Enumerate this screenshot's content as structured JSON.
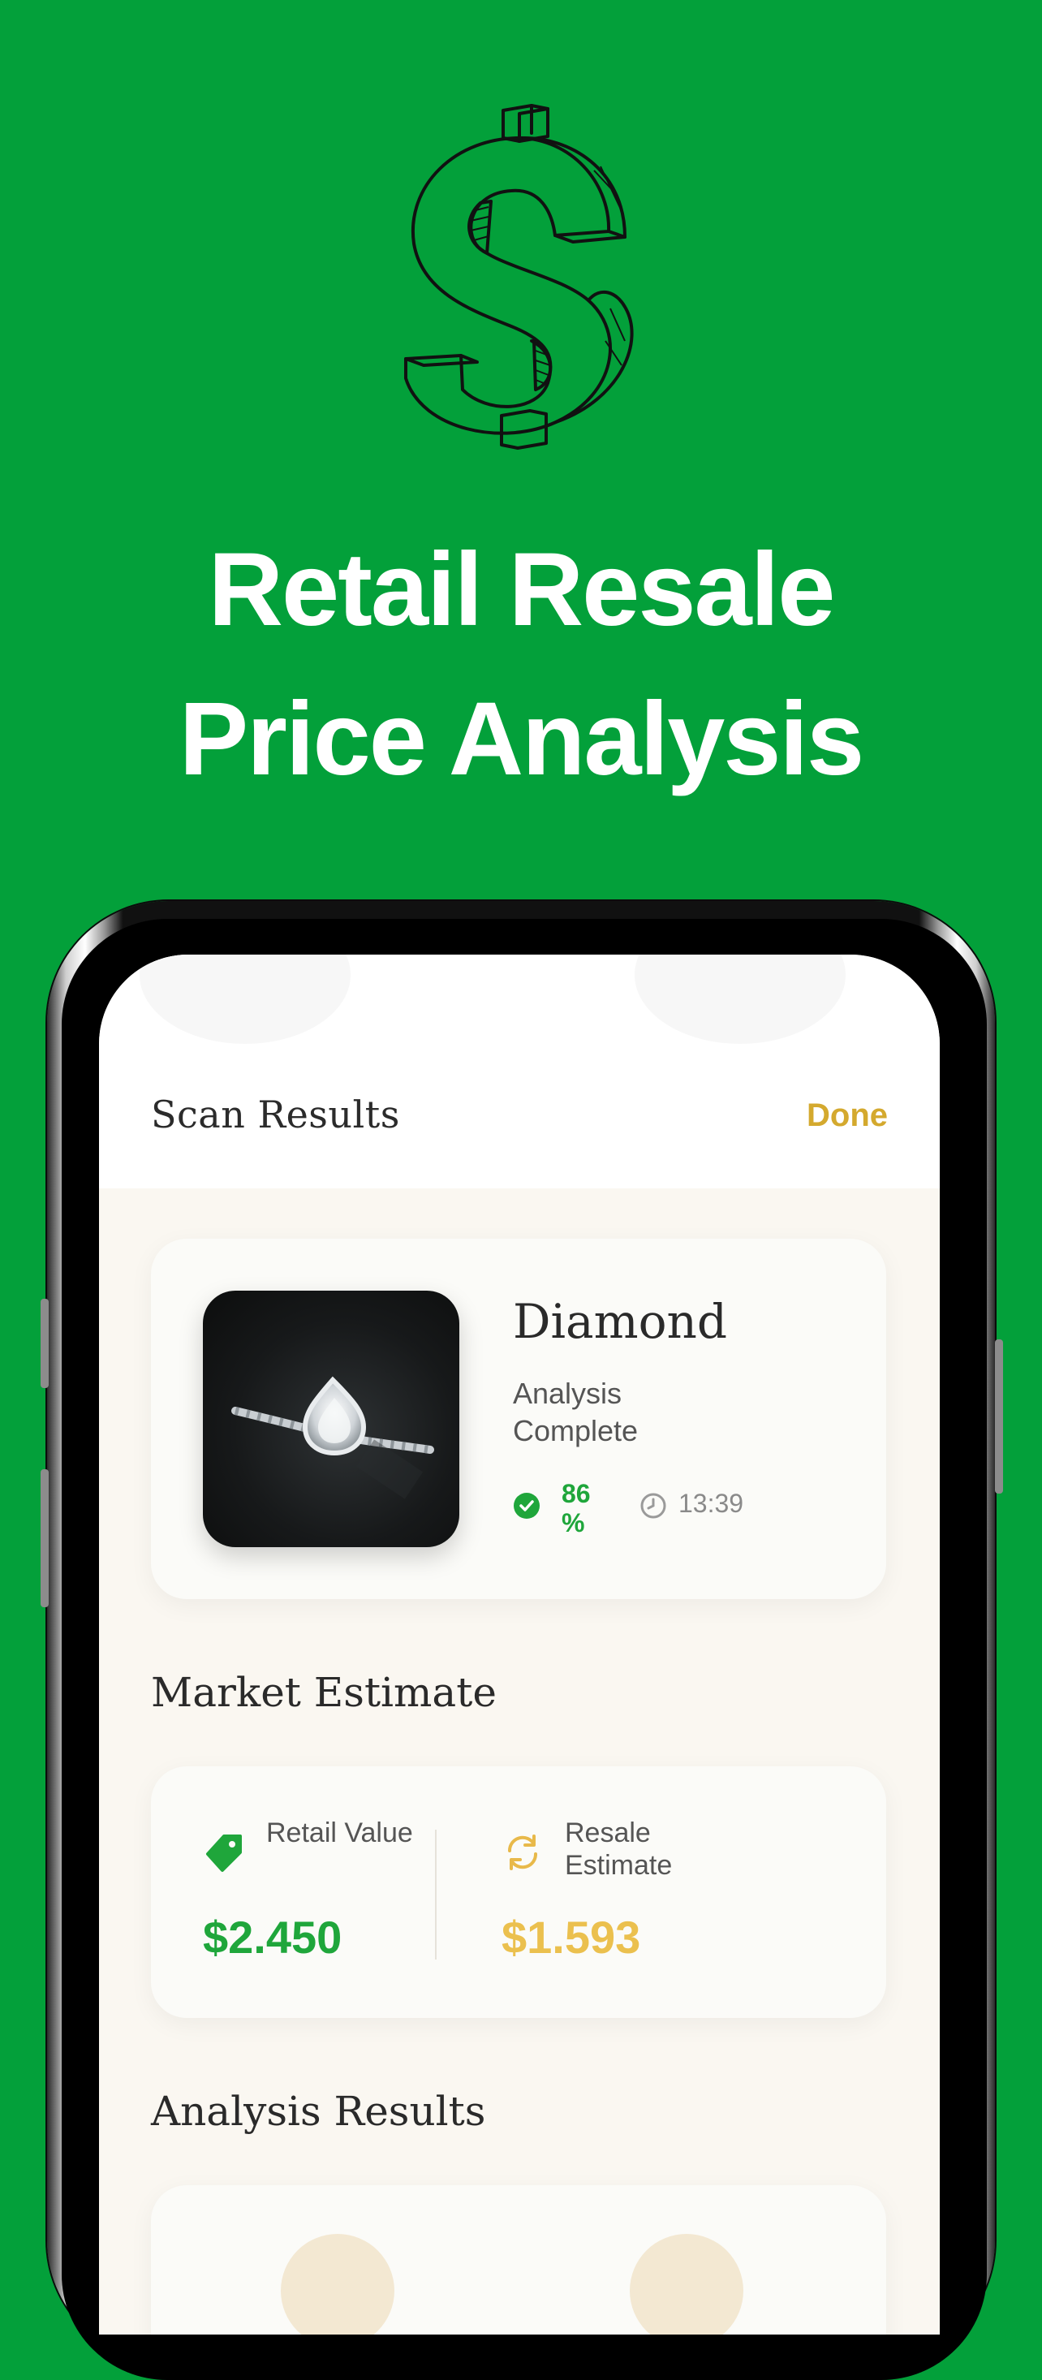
{
  "hero": {
    "icon": "dollar-sign-icon",
    "headline_line1": "Retail Resale",
    "headline_line2": "Price Analysis"
  },
  "nav": {
    "title": "Scan Results",
    "done_label": "Done"
  },
  "item": {
    "name": "Diamond",
    "status": "Analysis Complete",
    "confidence": "86 %",
    "time": "13:39",
    "image": "diamond-ring-image"
  },
  "market": {
    "section_title": "Market Estimate",
    "retail_label": "Retail Value",
    "retail_value": "$2.450",
    "resale_label": "Resale Estimate",
    "resale_value": "$1.593"
  },
  "analysis": {
    "section_title": "Analysis Results"
  },
  "colors": {
    "background": "#03A03A",
    "accent_gold": "#D4A92E",
    "success_green": "#1FA63B"
  }
}
